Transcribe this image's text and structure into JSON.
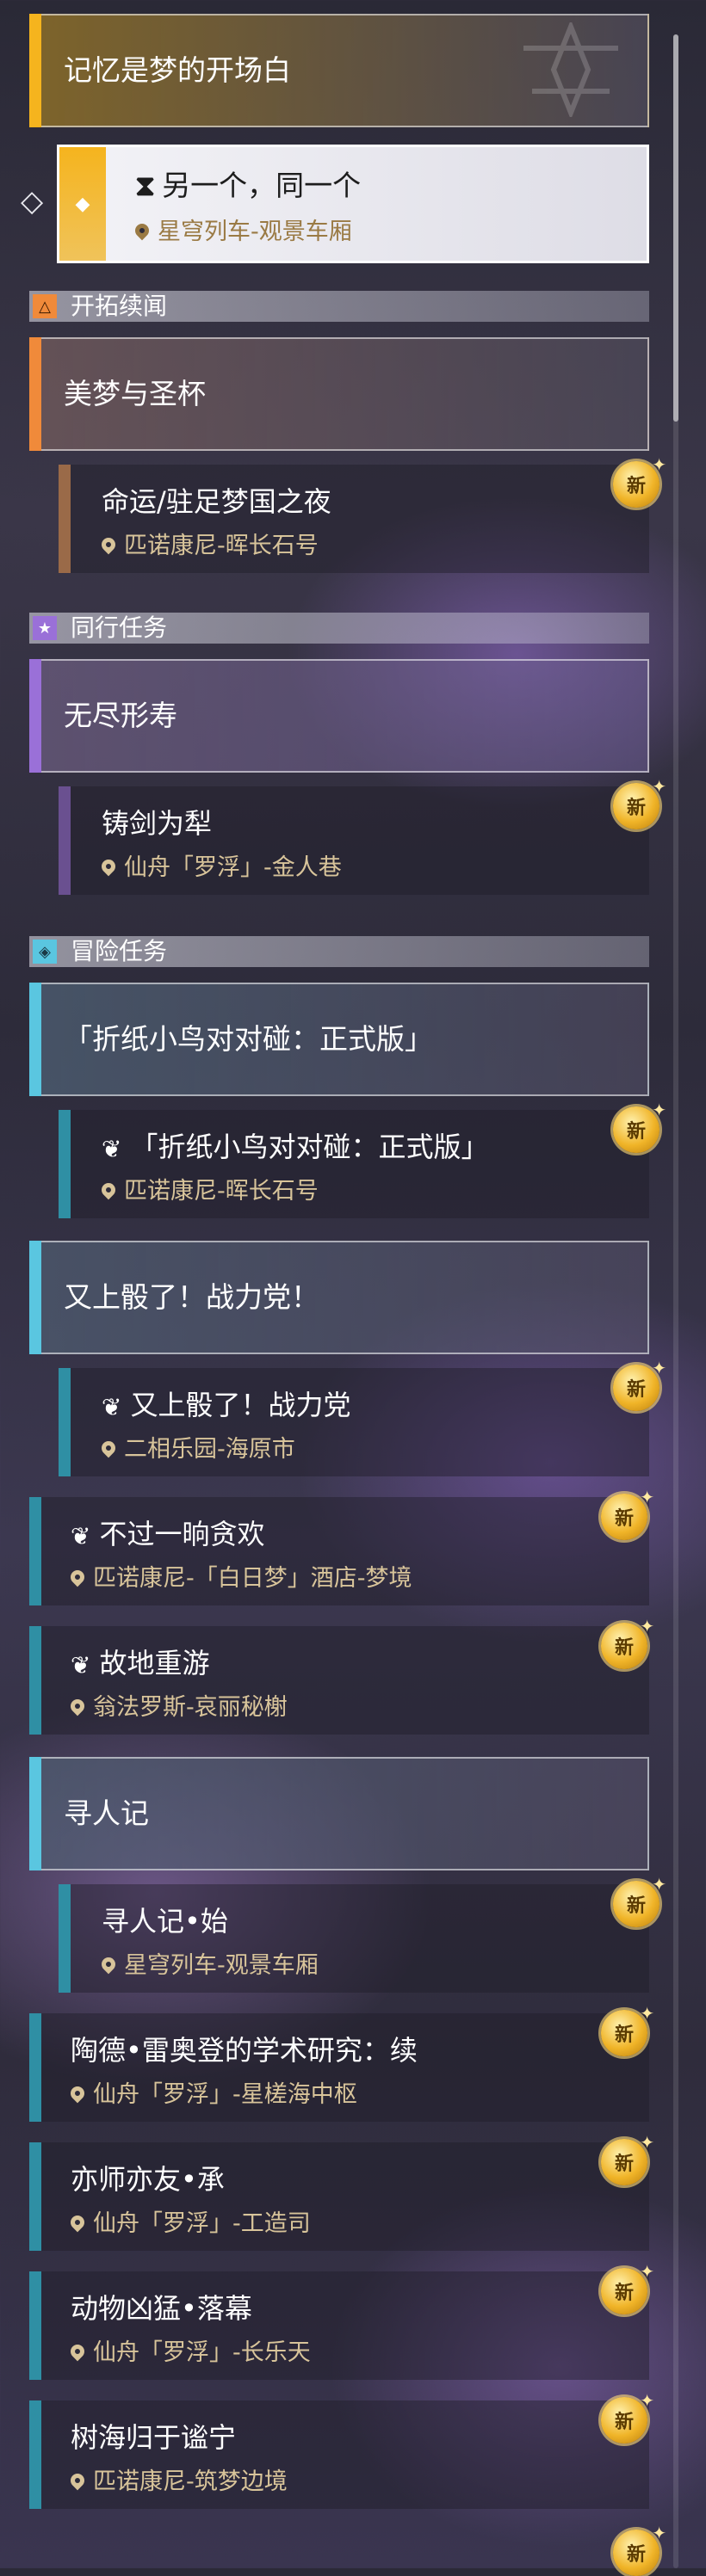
{
  "top_quest": {
    "title": "记忆是梦的开场白"
  },
  "featured": {
    "icon": "hourglass-icon",
    "title": "另一个，同一个",
    "location": "星穹列车-观景车厢"
  },
  "sections": {
    "trailblaze": "开拓续闻",
    "companion": "同行任务",
    "adventure": "冒险任务"
  },
  "quests": {
    "q1": {
      "title": "美梦与圣杯"
    },
    "q1s": {
      "title": "命运/驻足梦国之夜",
      "location": "匹诺康尼-晖长石号"
    },
    "q2": {
      "title": "无尽形寿"
    },
    "q2s": {
      "title": "铸剑为犁",
      "location": "仙舟「罗浮」-金人巷"
    },
    "q3": {
      "title": "「折纸小鸟对对碰：正式版」"
    },
    "q3s": {
      "title": "「折纸小鸟对对碰：正式版」",
      "location": "匹诺康尼-晖长石号"
    },
    "q4": {
      "title": "又上骰了！战力党！"
    },
    "q4s": {
      "title": "又上骰了！战力党",
      "location": "二相乐园-海原市"
    },
    "q5": {
      "title": "不过一晌贪欢",
      "location": "匹诺康尼-「白日梦」酒店-梦境"
    },
    "q6": {
      "title": "故地重游",
      "location": "翁法罗斯-哀丽秘榭"
    },
    "q7": {
      "title": "寻人记"
    },
    "q7s": {
      "title": "寻人记•始",
      "location": "星穹列车-观景车厢"
    },
    "q8": {
      "title": "陶德•雷奥登的学术研究：续",
      "location": "仙舟「罗浮」-星槎海中枢"
    },
    "q9": {
      "title": "亦师亦友•承",
      "location": "仙舟「罗浮」-工造司"
    },
    "q10": {
      "title": "动物凶猛•落幕",
      "location": "仙舟「罗浮」-长乐天"
    },
    "q11": {
      "title": "树海归于谧宁",
      "location": "匹诺康尼-筑梦边境"
    }
  },
  "new_label": "新",
  "colors": {
    "gold": "#f5b41e",
    "orange": "#f08a3a",
    "purple": "#9a70d8",
    "cyan": "#5ac6e0",
    "teal": "#2f8fa4"
  }
}
